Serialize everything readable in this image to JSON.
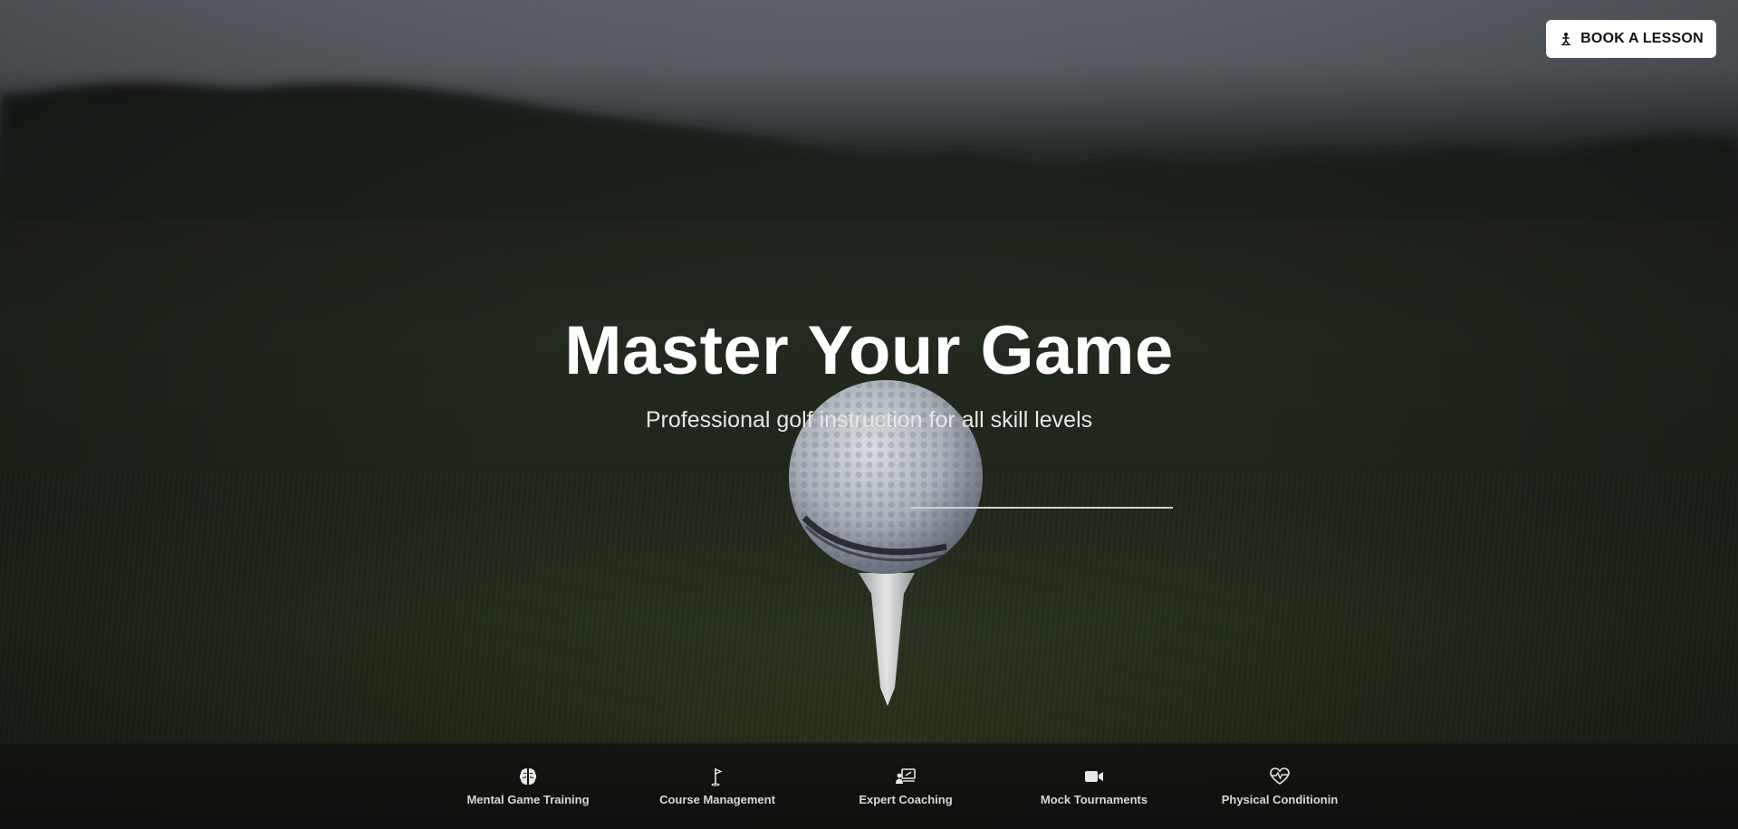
{
  "header": {
    "book_button_label": "BOOK A LESSON",
    "book_button_icon": "golfer-icon"
  },
  "hero": {
    "title": "Master Your Game",
    "subtitle": "Professional golf instruction for all skill levels",
    "background": "golf-ball-on-tee-photo"
  },
  "features": [
    {
      "label": "Mental Game Training",
      "icon": "brain-icon"
    },
    {
      "label": "Course Management",
      "icon": "flag-icon"
    },
    {
      "label": "Expert Coaching",
      "icon": "presentation-icon"
    },
    {
      "label": "Mock Tournaments",
      "icon": "video-camera-icon"
    },
    {
      "label": "Physical Conditionin",
      "icon": "heart-pulse-icon"
    }
  ],
  "colors": {
    "button_bg": "#ffffff",
    "text_primary": "#ffffff",
    "feature_bar_bg": "#121410"
  }
}
